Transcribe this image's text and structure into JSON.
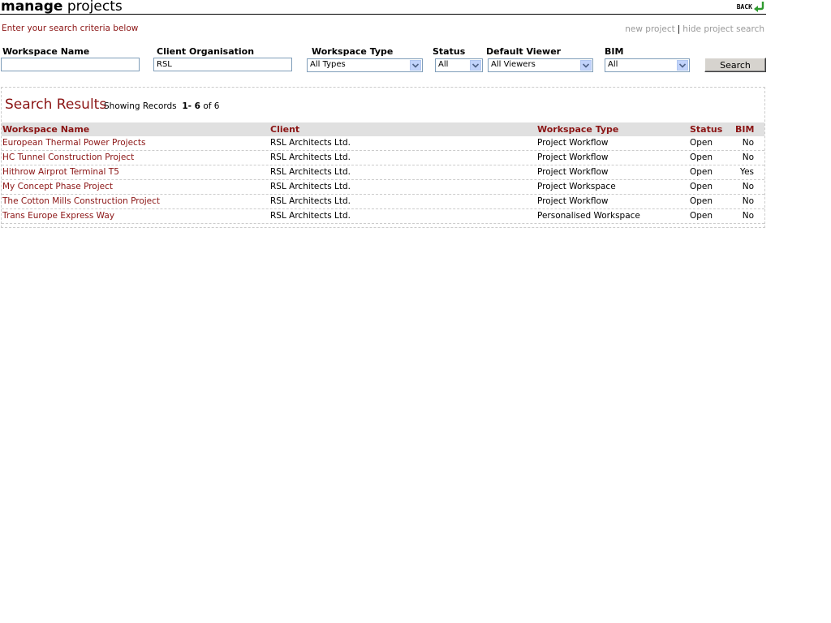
{
  "header": {
    "title_bold": "manage",
    "title_rest": " projects",
    "back_label": "BACK"
  },
  "subtitle": "Enter your search criteria below",
  "links": {
    "new_project": "new project",
    "separator": "|",
    "hide_search": "hide project search"
  },
  "filters": {
    "workspace_name": {
      "label": "Workspace Name",
      "value": ""
    },
    "client_org": {
      "label": "Client Organisation",
      "value": "RSL"
    },
    "workspace_type": {
      "label": "Workspace Type",
      "selected": "All Types"
    },
    "status": {
      "label": "Status",
      "selected": "All"
    },
    "default_viewer": {
      "label": "Default Viewer",
      "selected": "All Viewers"
    },
    "bim": {
      "label": "BIM",
      "selected": "All"
    },
    "search_label": "Search"
  },
  "results": {
    "title": "Search Results",
    "showing_prefix": "Showing Records",
    "range": "1- 6",
    "of_label": "of",
    "total": "6",
    "columns": [
      "Workspace Name",
      "Client",
      "Workspace Type",
      "Status",
      "BIM"
    ],
    "rows": [
      [
        "European Thermal Power Projects",
        "RSL Architects Ltd.",
        "Project Workflow",
        "Open",
        "No"
      ],
      [
        "HC Tunnel Construction Project",
        "RSL Architects Ltd.",
        "Project Workflow",
        "Open",
        "No"
      ],
      [
        "Hithrow Airprot Terminal T5",
        "RSL Architects Ltd.",
        "Project Workflow",
        "Open",
        "Yes"
      ],
      [
        "My Concept Phase Project",
        "RSL Architects Ltd.",
        "Project Workspace",
        "Open",
        "No"
      ],
      [
        "The Cotton Mills Construction Project",
        "RSL Architects Ltd.",
        "Project Workflow",
        "Open",
        "No"
      ],
      [
        "Trans Europe Express Way",
        "RSL Architects Ltd.",
        "Personalised Workspace",
        "Open",
        "No"
      ]
    ]
  },
  "colors": {
    "accent": "#8b1414",
    "header_bg": "#e0e0e0",
    "link_muted": "#999999"
  }
}
